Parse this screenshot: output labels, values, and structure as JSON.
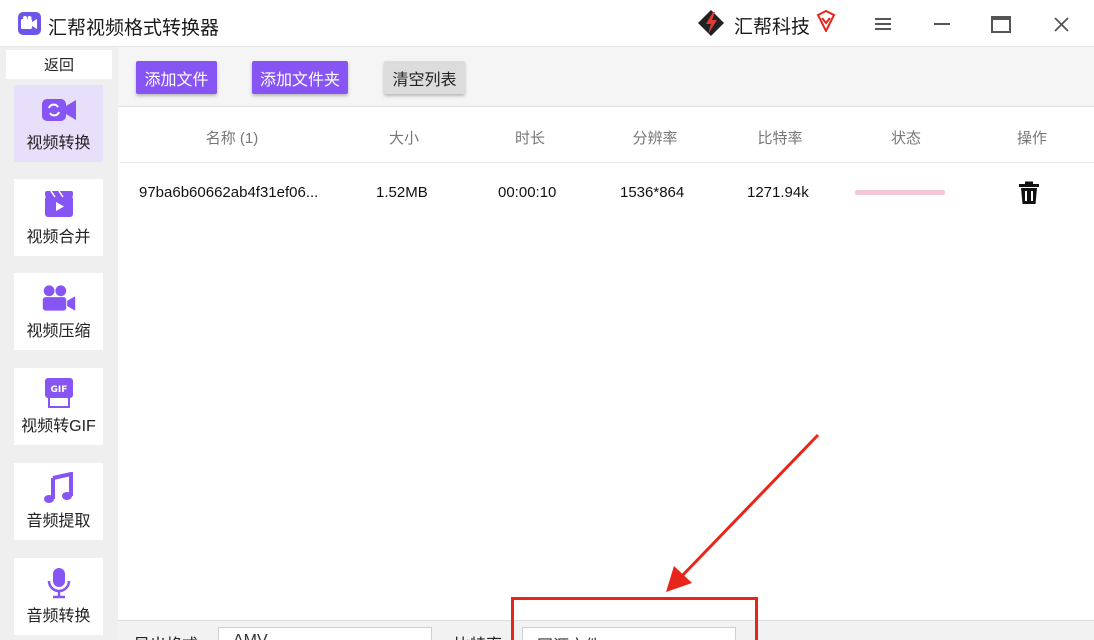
{
  "app": {
    "title": "汇帮视频格式转换器",
    "brand": "汇帮科技"
  },
  "colors": {
    "accent": "#8855f5",
    "active_nav": "#e8e0fb",
    "annotation": "#e8251b"
  },
  "sidebar": {
    "back": "返回",
    "items": [
      {
        "label": "视频转换",
        "icon": "video-convert-icon",
        "active": true
      },
      {
        "label": "视频合并",
        "icon": "video-merge-icon",
        "active": false
      },
      {
        "label": "视频压缩",
        "icon": "video-compress-icon",
        "active": false
      },
      {
        "label": "视频转GIF",
        "icon": "gif-icon",
        "active": false
      },
      {
        "label": "音频提取",
        "icon": "music-note-icon",
        "active": false
      },
      {
        "label": "音频转换",
        "icon": "microphone-icon",
        "active": false
      }
    ]
  },
  "toolbar": {
    "add_file": "添加文件",
    "add_folder": "添加文件夹",
    "clear_list": "清空列表"
  },
  "table": {
    "headers": {
      "name": "名称 (1)",
      "size": "大小",
      "duration": "时长",
      "resolution": "分辨率",
      "bitrate": "比特率",
      "status": "状态",
      "actions": "操作"
    },
    "rows": [
      {
        "name": "97ba6b60662ab4f31ef06...",
        "size": "1.52MB",
        "duration": "00:00:10",
        "resolution": "1536*864",
        "bitrate": "1271.94k"
      }
    ]
  },
  "bottom": {
    "format_label": "导出格式",
    "format_value": "AMV",
    "bitrate_label": "比特率",
    "bitrate_value": "同源文件"
  }
}
